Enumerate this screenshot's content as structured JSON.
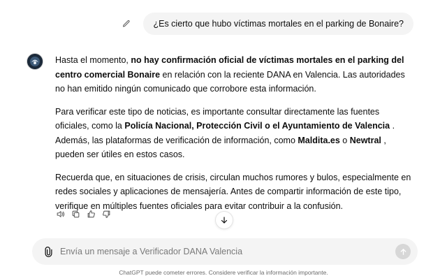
{
  "user_message": {
    "text": "¿Es cierto que hubo víctimas mortales en el parking de Bonaire?"
  },
  "assistant_message": {
    "p1": {
      "a": "Hasta el momento, ",
      "b": "no hay confirmación oficial de víctimas mortales en el parking del centro comercial Bonaire",
      "c": " en relación con la reciente DANA en Valencia. Las autoridades no han emitido ningún comunicado que corrobore esta información."
    },
    "p2": {
      "a": "Para verificar este tipo de noticias, es importante consultar directamente las fuentes oficiales, como la ",
      "b": "Policía Nacional, Protección Civil o el Ayuntamiento de Valencia",
      "c": " . Además, las plataformas de verificación de información, como ",
      "d": "Maldita.es",
      "e": " o ",
      "f": "Newtral",
      "g": " , pueden ser útiles en estos casos."
    },
    "p3": {
      "text": "Recuerda que, en situaciones de crisis, circulan muchos rumores y bulos, especialmente en redes sociales y aplicaciones de mensajería. Antes de compartir información de este tipo, verifique en múltiples fuentes oficiales para evitar contribuir a la confusión."
    }
  },
  "icons": {
    "edit": "pencil-icon",
    "read_aloud": "speaker-icon",
    "copy": "copy-icon",
    "like": "thumbs-up-icon",
    "dislike": "thumbs-down-icon",
    "scroll": "arrow-down-icon",
    "attach": "paperclip-icon",
    "send": "arrow-up-icon"
  },
  "composer": {
    "placeholder": "Envía un mensaje a Verificador DANA Valencia"
  },
  "footer": {
    "disclaimer": "ChatGPT puede cometer errores. Considere verificar la información importante."
  },
  "colors": {
    "bubble": "#f4f4f4",
    "text": "#0d0d0d",
    "muted": "#6b6b6b",
    "send_disabled": "#d7d7d7"
  }
}
